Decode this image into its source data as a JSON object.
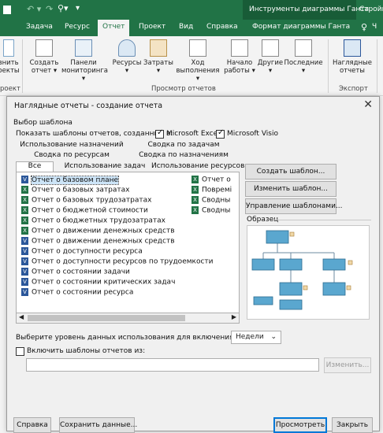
{
  "titlebar": {
    "tools_title": "Инструменты диаграммы Ганта",
    "right_title": "Стройка"
  },
  "ribbon_tabs": {
    "items": [
      "Задача",
      "Ресурс",
      "Отчет",
      "Проект",
      "Вид",
      "Справка",
      "Формат диаграммы Ганта"
    ],
    "active": "Отчет",
    "help_icon_label": "Ч"
  },
  "ribbon": {
    "left_cut_1": "авнить",
    "left_cut_2": "роекты",
    "left_group_cut": "роект",
    "create_report_1": "Создать",
    "create_report_2": "отчет ▾",
    "dashboards_1": "Панели",
    "dashboards_2": "мониторинга ▾",
    "resources": "Ресурсы ▾",
    "costs": "Затраты ▾",
    "progress_1": "Ход",
    "progress_2": "выполнения ▾",
    "getting_started_1": "Начало",
    "getting_started_2": "работы ▾",
    "other": "Другие ▾",
    "recent_1": "Последние",
    "recent_2": "▾",
    "visual_reports_1": "Наглядные",
    "visual_reports_2": "отчеты",
    "group_view_reports": "Просмотр отчетов",
    "group_export": "Экспорт"
  },
  "dialog": {
    "title": "Наглядные отчеты - создание отчета",
    "section_label": "Выбор шаблона",
    "show_templates_label": "Показать шаблоны отчетов, созданные в:",
    "excel_label": "Microsoft Excel",
    "visio_label": "Microsoft Visio",
    "excel_checked": true,
    "visio_checked": true,
    "tabs_row1": [
      "Использование назначений",
      "Сводка по задачам"
    ],
    "tabs_row2": [
      "Сводка по ресурсам",
      "Сводка по назначениям"
    ],
    "tabs_row3": [
      "Все",
      "Использование задач",
      "Использование ресурсов"
    ],
    "active_tab": "Все",
    "templates_col1": [
      "Отчет о базовом плане",
      "Отчет о базовых затратах",
      "Отчет о базовых трудозатратах",
      "Отчет о бюджетной стоимости",
      "Отчет о бюджетных трудозатратах",
      "Отчет о движении денежных средств",
      "Отчет о движении денежных средств",
      "Отчет о доступности ресурса",
      "Отчет о доступности ресурсов по трудоемкости",
      "Отчет о состоянии задачи",
      "Отчет о состоянии критических задач",
      "Отчет о состоянии ресурса"
    ],
    "templates_col1_types": [
      "V",
      "X",
      "X",
      "X",
      "X",
      "X",
      "V",
      "V",
      "V",
      "V",
      "V",
      "V"
    ],
    "templates_col2": [
      "Отчет о",
      "Повремі",
      "Сводны",
      "Сводны"
    ],
    "selected_template": "Отчет о базовом плане",
    "btn_create": "Создать шаблон...",
    "btn_edit": "Изменить шаблон...",
    "btn_manage": "Управление шаблонами...",
    "preview_label": "Образец",
    "level_label": "Выберите уровень данных использования для включения в отчет:",
    "level_value": "Недели",
    "include_label": "Включить шаблоны отчетов из:",
    "include_path": "",
    "btn_modify": "Изменить...",
    "btn_help": "Справка",
    "btn_save_data": "Сохранить данные...",
    "btn_view": "Просмотреть",
    "btn_close": "Закрыть"
  },
  "colors": {
    "excel_green": "#217346",
    "visio_blue": "#2b579a",
    "preview_node": "#5aa7cf"
  }
}
